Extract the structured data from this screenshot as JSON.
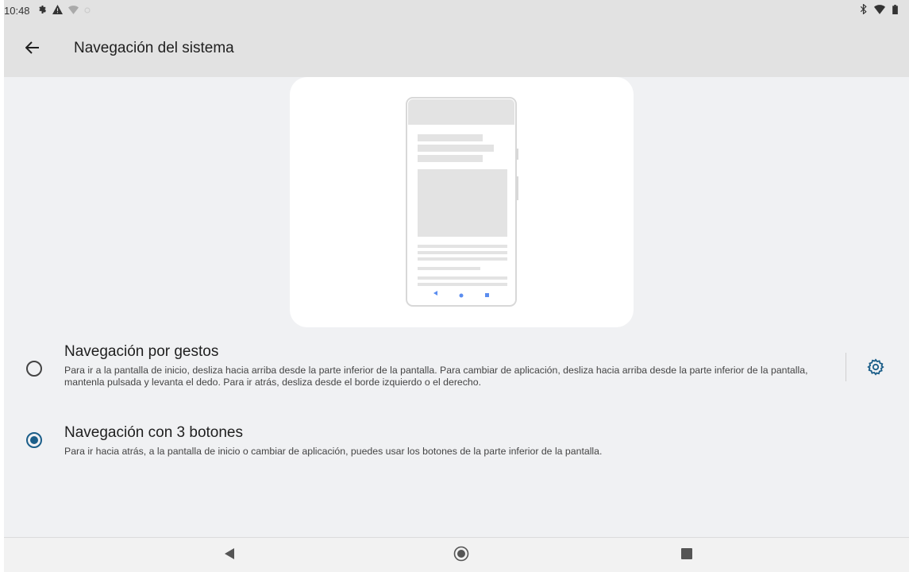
{
  "status_bar": {
    "time": "10:48",
    "left_icons": [
      "settings-gear-icon",
      "warning-icon",
      "wifi-off-icon",
      "small-icon"
    ],
    "right_icons": [
      "bluetooth-icon",
      "wifi-icon",
      "battery-icon"
    ]
  },
  "app_bar": {
    "title": "Navegación del sistema",
    "back_icon": "arrow-back-icon"
  },
  "options": {
    "gestures": {
      "title": "Navegación por gestos",
      "description": "Para ir a la pantalla de inicio, desliza hacia arriba desde la parte inferior de la pantalla. Para cambiar de aplicación, desliza hacia arriba desde la parte inferior de la pantalla, mantenla pulsada y levanta el dedo. Para ir atrás, desliza desde el borde izquierdo o el derecho.",
      "selected": false,
      "settings_icon": "gear-settings-icon"
    },
    "three_buttons": {
      "title": "Navegación con 3 botones",
      "description": "Para ir hacia atrás, a la pantalla de inicio o cambiar de aplicación, puedes usar los botones de la parte inferior de la pantalla.",
      "selected": true
    }
  },
  "nav_bar": {
    "icons": [
      "back-triangle-icon",
      "home-circle-icon",
      "recents-square-icon"
    ]
  },
  "colors": {
    "accent": "#1b5e89",
    "illustration_nav": "#5b8def"
  }
}
